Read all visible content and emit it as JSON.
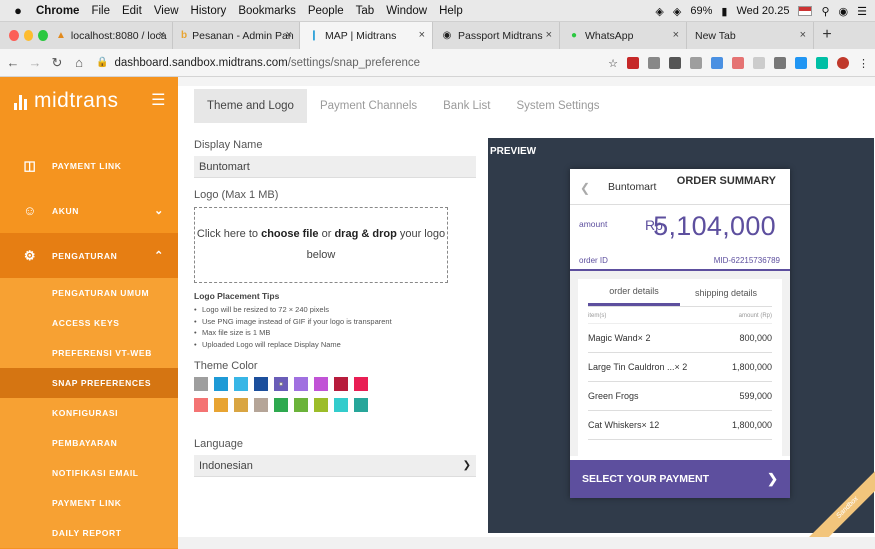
{
  "menubar": {
    "app": "Chrome",
    "items": [
      "File",
      "Edit",
      "View",
      "History",
      "Bookmarks",
      "People",
      "Tab",
      "Window",
      "Help"
    ],
    "battery": "69%",
    "clock": "Wed 20.25"
  },
  "tabs": [
    {
      "title": "localhost:8080 / loca",
      "active": false
    },
    {
      "title": "Pesanan - Admin Pan",
      "active": false
    },
    {
      "title": "MAP | Midtrans",
      "active": true
    },
    {
      "title": "Passport Midtrans",
      "active": false
    },
    {
      "title": "WhatsApp",
      "active": false
    },
    {
      "title": "New Tab",
      "active": false
    }
  ],
  "address": {
    "domain": "dashboard.sandbox.midtrans.com",
    "path": "/settings/snap_preference"
  },
  "sidebar": {
    "brand": "midtrans",
    "items": [
      {
        "label": "PAYMENT LINK"
      },
      {
        "label": "AKUN"
      },
      {
        "label": "PENGATURAN"
      }
    ],
    "subitems": [
      {
        "label": "PENGATURAN UMUM"
      },
      {
        "label": "ACCESS KEYS"
      },
      {
        "label": "PREFERENSI VT-WEB"
      },
      {
        "label": "SNAP PREFERENCES"
      },
      {
        "label": "KONFIGURASI"
      },
      {
        "label": "PEMBAYARAN"
      },
      {
        "label": "NOTIFIKASI EMAIL"
      },
      {
        "label": "PAYMENT LINK"
      },
      {
        "label": "DAILY REPORT"
      }
    ]
  },
  "page": {
    "tabs": [
      "Theme and Logo",
      "Payment Channels",
      "Bank List",
      "System Settings"
    ],
    "display_name_label": "Display Name",
    "display_name_value": "Buntomart",
    "logo_label": "Logo (Max 1 MB)",
    "drop_pre": "Click here to ",
    "drop_choose": "choose file",
    "drop_or": " or ",
    "drop_drag": "drag & drop",
    "drop_post": " your logo",
    "drop_below": "below",
    "tips_title": "Logo Placement Tips",
    "tips": [
      "Logo will be resized to 72 × 240 pixels",
      "Use PNG image instead of GIF if your logo is transparent",
      "Max file size is 1 MB",
      "Uploaded Logo will replace Display Name"
    ],
    "theme_color_label": "Theme Color",
    "colors": [
      "#9e9e9e",
      "#1e9ad6",
      "#38b6e6",
      "#1c4f9c",
      "#6a5db8",
      "#a070e0",
      "#c153d6",
      "#b71c3c",
      "#e91e54",
      "#f47373",
      "#e8a432",
      "#d9a542",
      "#b5a598",
      "#2ea94f",
      "#6bb33a",
      "#9cbd29",
      "#33cccc",
      "#27a69a"
    ],
    "selected_color_index": 4,
    "language_label": "Language",
    "language_value": "Indonesian"
  },
  "preview": {
    "title": "PREVIEW",
    "merchant": "Buntomart",
    "order_summary": "ORDER SUMMARY",
    "amount_label": "amount",
    "currency": "Rp",
    "amount": "5,104,000",
    "order_id_label": "order ID",
    "order_id": "MID-62215736789",
    "tab_details": "order details",
    "tab_shipping": "shipping details",
    "col_item": "item(s)",
    "col_amount": "amount (Rp)",
    "items": [
      {
        "name": "Magic Wand× 2",
        "amount": "800,000"
      },
      {
        "name": "Large Tin Cauldron ...× 2",
        "amount": "1,800,000"
      },
      {
        "name": "Green Frogs",
        "amount": "599,000"
      },
      {
        "name": "Cat Whiskers× 12",
        "amount": "1,800,000"
      }
    ],
    "cta": "SELECT YOUR PAYMENT",
    "ribbon": "Sandbox"
  }
}
